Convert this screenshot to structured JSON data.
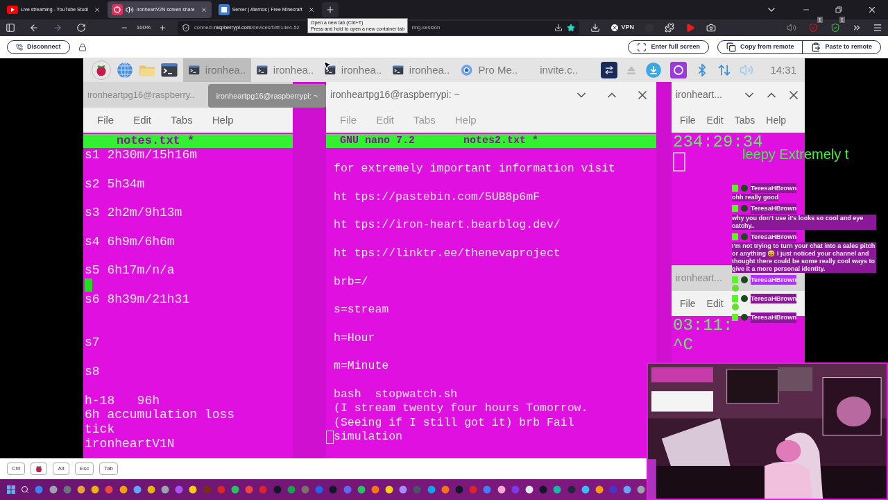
{
  "browser": {
    "tabs": [
      {
        "title": "Live streaming - YouTube Studi",
        "kind": "youtube",
        "audio": false,
        "selected": false
      },
      {
        "title": "ironheartV2N screen share",
        "kind": "pi",
        "audio": true,
        "selected": true
      },
      {
        "title": "Server | Aternos | Free Minecraft",
        "kind": "aternos",
        "audio": false,
        "selected": false
      }
    ],
    "tooltip": [
      "Open a new tab (Ctrl+T)",
      "Press and hold to open a new container tab"
    ],
    "zoom": "100%",
    "url_prefix": "connect.",
    "url_domain": "raspberrypi.com",
    "url_path": "/devices/f3fb14e4-52",
    "url_tail": "ring-session",
    "vpn": "VPN",
    "badges": [
      "1",
      "1"
    ]
  },
  "remote_bar": {
    "disconnect": "Disconnect",
    "buttons": [
      {
        "label": "Enter full screen",
        "kind": "fullscreen"
      },
      {
        "label": "Copy from remote",
        "kind": "copy"
      },
      {
        "label": "Paste to remote",
        "kind": "paste"
      }
    ]
  },
  "pi_panel": {
    "launchers": [
      {
        "kind": "raspberry"
      },
      {
        "kind": "globe"
      },
      {
        "kind": "folder"
      },
      {
        "kind": "terminal"
      }
    ],
    "tasks": [
      {
        "label": "ironhea..",
        "kind": "terminal",
        "selected": true
      },
      {
        "label": "ironhea..",
        "kind": "terminal",
        "selected": false
      },
      {
        "label": "ironhea..",
        "kind": "terminal",
        "selected": false
      },
      {
        "label": "ironhea..",
        "kind": "terminal",
        "selected": false
      },
      {
        "label": "Pro Me..",
        "kind": "chromium",
        "selected": false
      },
      {
        "label": "invite.c..",
        "kind": "plain",
        "selected": false
      }
    ],
    "clock": "14:31"
  },
  "floating_title": "ironheartpg16@raspberrypi: ~",
  "terminals": [
    {
      "title": "ironheartpg16@raspberry..",
      "menu": [
        "File",
        "Edit",
        "Tabs",
        "Help"
      ],
      "header": [
        "notes.txt *"
      ],
      "lines": [
        {
          "kind": "line",
          "text": "s1 2h30m/15h16m"
        },
        {
          "kind": "blank"
        },
        {
          "kind": "line",
          "text": "s2 5h34m"
        },
        {
          "kind": "blank"
        },
        {
          "kind": "line",
          "text": "s3 2h2m/9h13m"
        },
        {
          "kind": "blank"
        },
        {
          "kind": "line",
          "text": "s4 6h9m/6h6m"
        },
        {
          "kind": "blank"
        },
        {
          "kind": "line",
          "text": "s5 6h17m/n/a"
        },
        {
          "kind": "cursor"
        },
        {
          "kind": "line",
          "text": "s6 8h39m/21h31"
        },
        {
          "kind": "blank"
        },
        {
          "kind": "blank"
        },
        {
          "kind": "line",
          "text": "s7"
        },
        {
          "kind": "blank"
        },
        {
          "kind": "line",
          "text": "s8"
        },
        {
          "kind": "blank"
        },
        {
          "kind": "line",
          "text": "h-18   96h"
        },
        {
          "kind": "line",
          "text": "6h accumulation loss"
        },
        {
          "kind": "line",
          "text": "tick"
        },
        {
          "kind": "line",
          "text": "ironheartV1N"
        }
      ]
    },
    {
      "title": "ironheartpg16@raspberrypi: ~",
      "menu": [
        "File",
        "Edit",
        "Tabs",
        "Help"
      ],
      "header": [
        "GNU nano 7.2",
        "notes2.txt *"
      ],
      "lines": [
        {
          "kind": "blank"
        },
        {
          "kind": "line",
          "text": "for extremely important information visit"
        },
        {
          "kind": "blank"
        },
        {
          "kind": "line",
          "text": "ht tps://pastebin.com/5UB8p6mF"
        },
        {
          "kind": "blank"
        },
        {
          "kind": "line",
          "text": "ht tps://iron-heart.bearblog.dev/"
        },
        {
          "kind": "blank"
        },
        {
          "kind": "line",
          "text": "ht tps://linktr.ee/thenevaproject"
        },
        {
          "kind": "blank"
        },
        {
          "kind": "line",
          "text": "brb=/"
        },
        {
          "kind": "blank"
        },
        {
          "kind": "line",
          "text": "s=stream"
        },
        {
          "kind": "blank"
        },
        {
          "kind": "line",
          "text": "h=Hour"
        },
        {
          "kind": "blank"
        },
        {
          "kind": "line",
          "text": "m=Minute"
        },
        {
          "kind": "blank"
        },
        {
          "kind": "line",
          "text": "bash  stopwatch.sh"
        },
        {
          "kind": "line",
          "text": "(I stream twenty four hours Tomorrow."
        },
        {
          "kind": "line",
          "text": "(Seeing if I still got it) brb Fail"
        },
        {
          "kind": "box_cursor_line",
          "text": "simulation"
        }
      ]
    },
    {
      "title": "ironheart...",
      "menu": [
        "File",
        "Edit",
        "Tabs",
        "Help"
      ],
      "lines": [
        {
          "kind": "line",
          "text": "234:29:34"
        },
        {
          "kind": "box_cursor"
        }
      ]
    },
    {
      "title": "ironheart...",
      "menu": [
        "File",
        "Edit"
      ],
      "lines": [
        {
          "kind": "line",
          "text": "03:11:"
        },
        {
          "kind": "line",
          "text": "^C"
        }
      ]
    }
  ],
  "stream_overlay": {
    "ticker": "leepy Extremely t",
    "chat": [
      {
        "user": "TeresaHBrown",
        "highlighted": false,
        "kind": "text",
        "text": "ohh really good"
      },
      {
        "user": "TeresaHBrown",
        "highlighted": false,
        "kind": "text",
        "text": "why you don't use it's looks so cool and eye catchy.."
      },
      {
        "user": "TeresaHBrown",
        "highlighted": false,
        "kind": "text",
        "text": "I'm not trying to turn your chat into a sales pitch or anything 😄 I just noticed your channel and thought there could be some really cool ways to give it a more personal identity."
      },
      {
        "user": "TeresaHBrown",
        "highlighted": true,
        "kind": "emote"
      },
      {
        "user": "TeresaHBrown",
        "highlighted": false,
        "kind": "emote"
      },
      {
        "user": "TeresaHBrown",
        "highlighted": false,
        "kind": "none"
      }
    ]
  },
  "keys": [
    {
      "kind": "text",
      "label": "Ctrl"
    },
    {
      "kind": "raspberry"
    },
    {
      "kind": "text",
      "label": "Alt"
    },
    {
      "kind": "text",
      "label": "Esc"
    },
    {
      "kind": "text",
      "label": "Tab"
    }
  ]
}
